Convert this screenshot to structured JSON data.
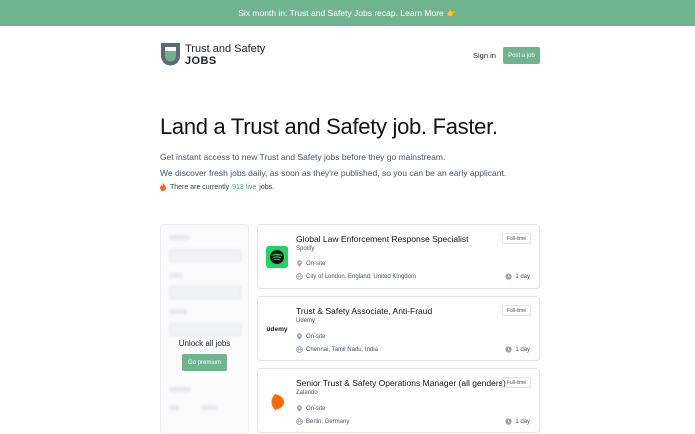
{
  "banner": {
    "text": "Six month in: Trust and Safety Jobs recap. Learn More",
    "emoji": "👉"
  },
  "logo": {
    "line1": "Trust and Safety",
    "line2": "JOBS"
  },
  "nav": {
    "signin": "Sign in",
    "post_job": "Post a job"
  },
  "hero": {
    "title": "Land a Trust and Safety job. Faster.",
    "subtitle_1": "Get instant access to new Trust and Safety jobs before they go mainstream.",
    "subtitle_2": "We discover fresh jobs daily, as soon as they're published, so you can be an early applicant.",
    "live_prefix": "There are currently",
    "live_count": "913 live",
    "live_suffix": "jobs."
  },
  "sidebar": {
    "unlock": "Unlock all jobs",
    "premium_button": "Go premium"
  },
  "jobs": [
    {
      "title": "Global Law Enforcement Response Specialist",
      "company": "Spotify",
      "work_mode": "On-site",
      "location": "City of London, England, United Kingdom",
      "type": "Full-time",
      "age": "1 day",
      "logo": "spotify-logo"
    },
    {
      "title": "Trust & Safety Associate, Anti-Fraud",
      "company": "Udemy",
      "work_mode": "On-site",
      "location": "Chennai, Tamil Nadu, India",
      "type": "Full-time",
      "age": "1 day",
      "logo_text": "ûdemy"
    },
    {
      "title": "Senior Trust & Safety Operations Manager (all genders)",
      "company": "Zalando",
      "work_mode": "On-site",
      "location": "Berlin, Germany",
      "type": "Full-time",
      "age": "1 day",
      "logo": "zalando-logo"
    }
  ],
  "colors": {
    "accent": "#6fb48f",
    "spotify": "#1ed760",
    "zalando": "#ff6900",
    "live_count": "#4a9d73"
  }
}
